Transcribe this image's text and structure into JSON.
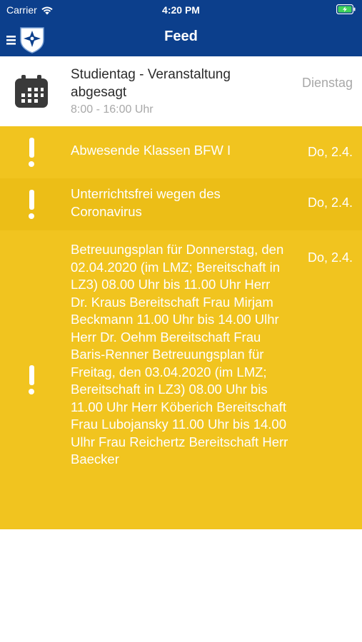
{
  "status_bar": {
    "carrier": "Carrier",
    "time": "4:20 PM",
    "icons": [
      "wifi-icon",
      "battery-charging-icon"
    ]
  },
  "header": {
    "title": "Feed",
    "icons": [
      "hamburger-menu-icon",
      "school-crest-logo"
    ],
    "background": "#0c3f8c"
  },
  "feed": {
    "event": {
      "title": "Studientag - Veranstaltung abgesagt",
      "time": "8:00 - 16:00 Uhr",
      "date": "Dienstag",
      "icon": "calendar-icon"
    },
    "alerts": [
      {
        "text": "Abwesende Klassen BFW I",
        "date": "Do, 2.4.",
        "icon": "exclamation-icon"
      },
      {
        "text": "Unterrichtsfrei wegen des Coronavirus",
        "date": "Do, 2.4.",
        "icon": "exclamation-icon"
      },
      {
        "text": "Betreuungsplan für Donnerstag, den 02.04.2020 (im LMZ; Bereitschaft in LZ3)  08.00 Uhr bis 11.00 Uhr  Herr Dr. Kraus Bereitschaft Frau Mirjam Beckmann   11.00 Uhr bis 14.00 Ulhr  Herr Dr. Oehm Bereitschaft Frau Baris-Renner Betreuungsplan für Freitag, den 03.04.2020 (im LMZ; Bereitschaft in LZ3)  08.00 Uhr bis 11.00 Uhr  Herr Köberich Bereitschaft Frau Lubojansky 11.00 Uhr bis 14.00 Ulhr  Frau Reichertz  Bereitschaft Herr Baecker",
        "date": "Do, 2.4.",
        "icon": "exclamation-icon"
      }
    ],
    "colors": {
      "alert": "#f1c41f",
      "alert_alt": "#ecbe17"
    }
  }
}
